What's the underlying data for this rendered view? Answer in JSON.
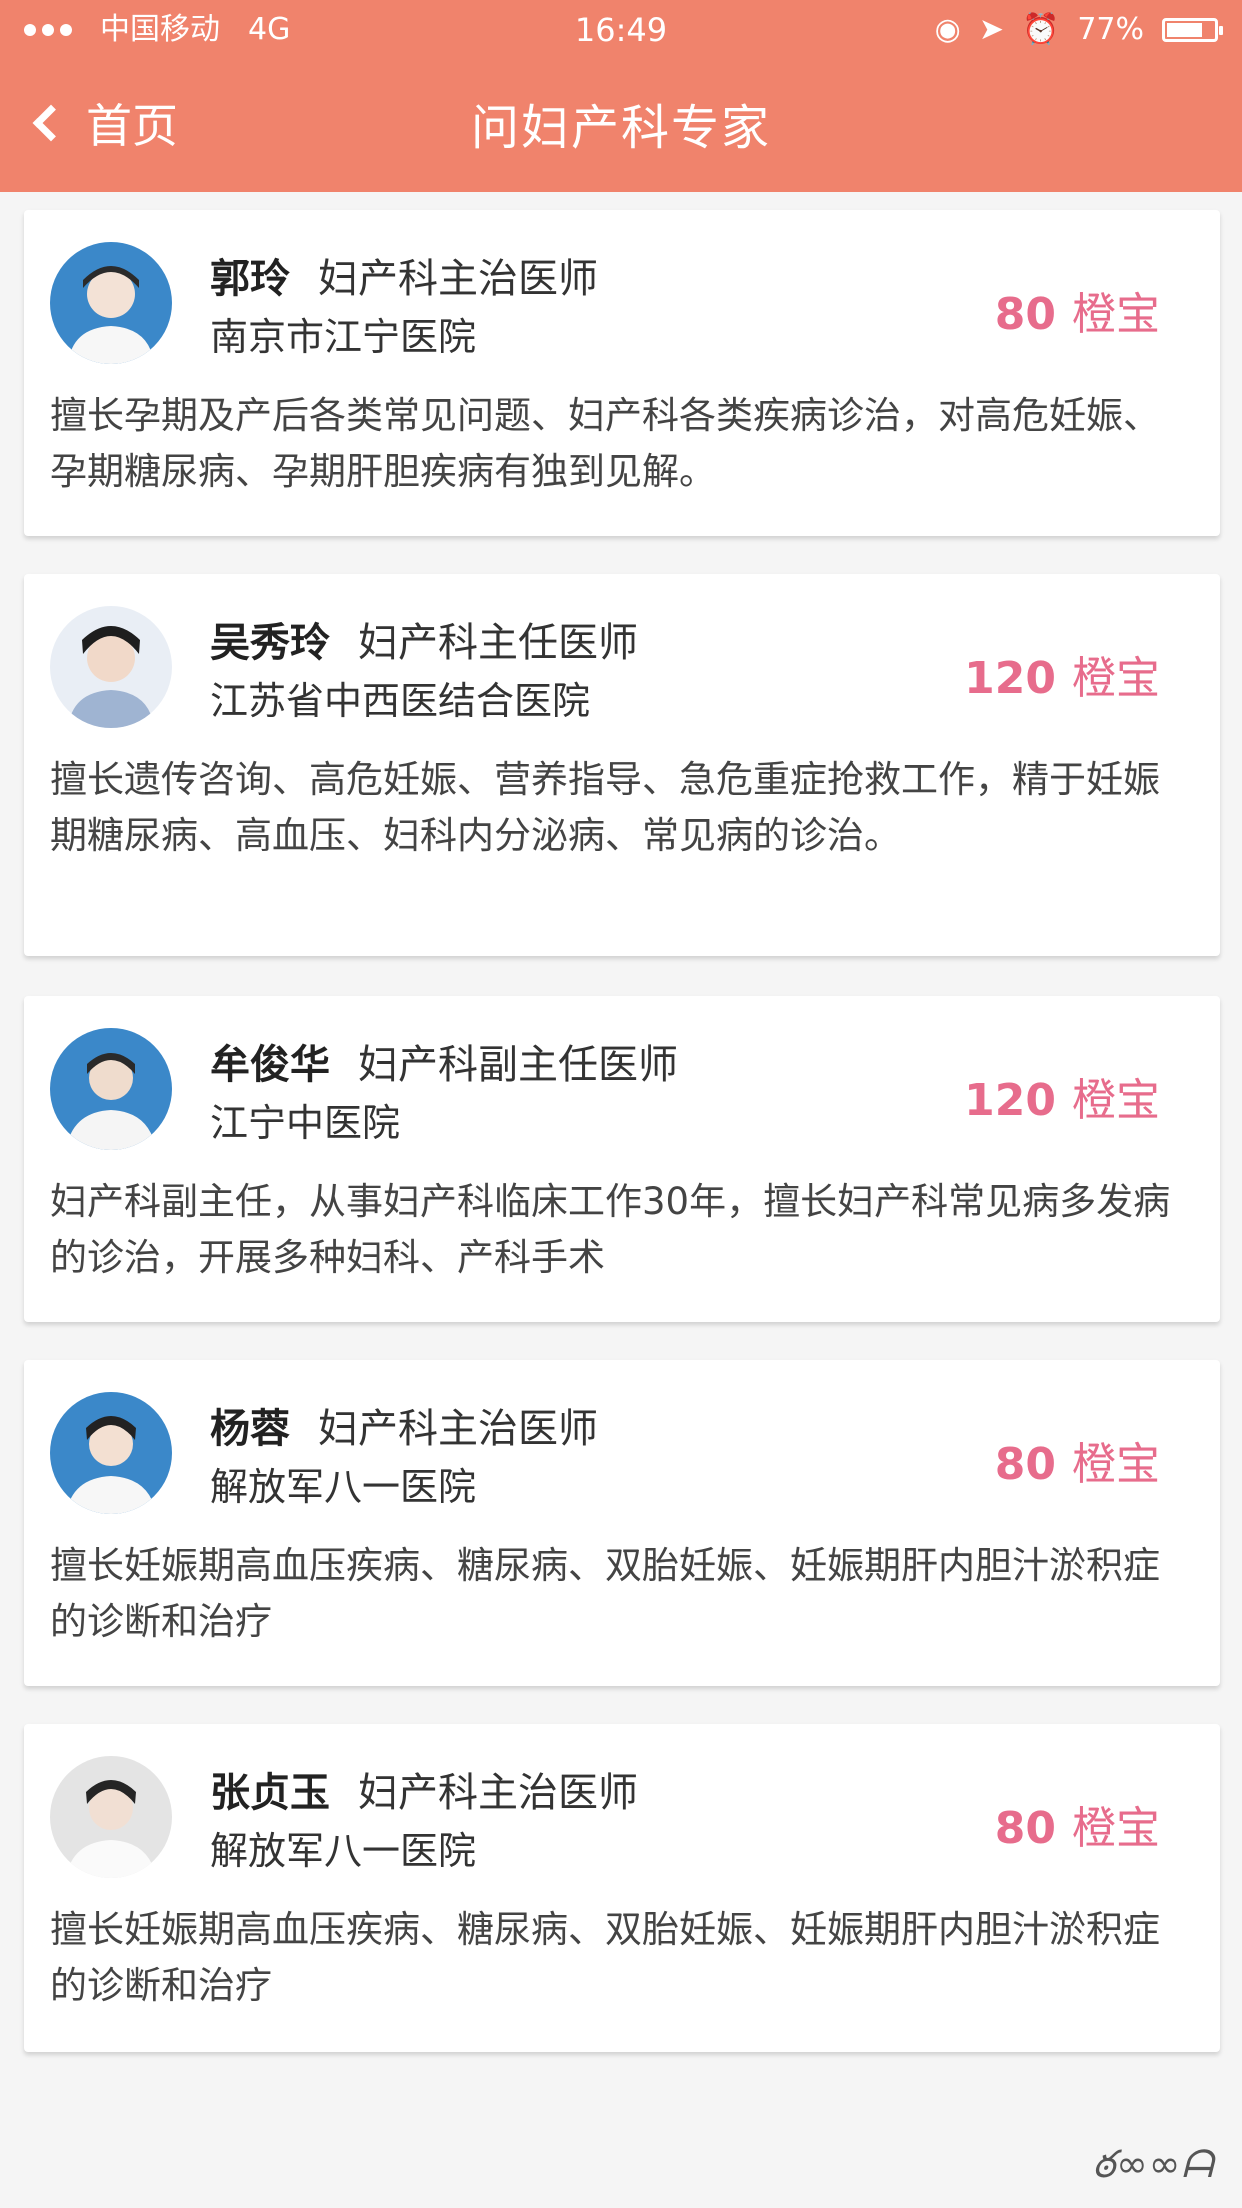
{
  "status_bar": {
    "carrier": "中国移动",
    "network": "4G",
    "time": "16:49",
    "battery": "77%",
    "battery_level": 0.77
  },
  "nav": {
    "back_label": "首页",
    "title": "问妇产科专家"
  },
  "doctors": [
    {
      "name": "郭玲",
      "title": "妇产科主治医师",
      "hospital": "南京市江宁医院",
      "price": "80",
      "unit": "橙宝",
      "description": "擅长孕期及产后各类常见问题、妇产科各类疾病诊治，对高危妊娠、孕期糖尿病、孕期肝胆疾病有独到见解。"
    },
    {
      "name": "吴秀玲",
      "title": "妇产科主任医师",
      "hospital": "江苏省中西医结合医院",
      "price": "120",
      "unit": "橙宝",
      "description": "擅长遗传咨询、高危妊娠、营养指导、急危重症抢救工作，精于妊娠期糖尿病、高血压、妇科内分泌病、常见病的诊治。"
    },
    {
      "name": "牟俊华",
      "title": "妇产科副主任医师",
      "hospital": "江宁中医院",
      "price": "120",
      "unit": "橙宝",
      "description": "妇产科副主任，从事妇产科临床工作30年，擅长妇产科常见病多发病的诊治，开展多种妇科、产科手术"
    },
    {
      "name": "杨蓉",
      "title": "妇产科主治医师",
      "hospital": "解放军八一医院",
      "price": "80",
      "unit": "橙宝",
      "description": "擅长妊娠期高血压疾病、糖尿病、双胎妊娠、妊娠期肝内胆汁淤积症的诊断和治疗"
    },
    {
      "name": "张贞玉",
      "title": "妇产科主治医师",
      "hospital": "解放军八一医院",
      "price": "80",
      "unit": "橙宝",
      "description": "擅长妊娠期高血压疾病、糖尿病、双胎妊娠、妊娠期肝内胆汁淤积症的诊断和治疗"
    }
  ],
  "colors": {
    "header": "#f0836c",
    "price": "#e76c8c"
  }
}
